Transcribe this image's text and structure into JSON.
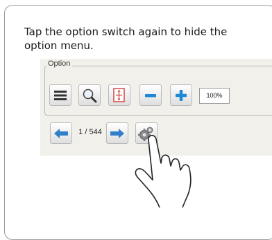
{
  "instruction": "Tap the option switch again to hide the option menu.",
  "option_group": {
    "legend": "Option",
    "zoom_value": "100%"
  },
  "navigation": {
    "page_indicator": "1 / 544"
  },
  "icons": [
    "menu-icon",
    "search-icon",
    "fit-page-icon",
    "zoom-out-icon",
    "zoom-in-icon",
    "previous-arrow-icon",
    "next-arrow-icon",
    "gear-icon",
    "hand-pointer-icon"
  ],
  "colors": {
    "panel": "#f2f0ea",
    "arrow": "#2f80c9",
    "plus": "#1e88d6"
  }
}
